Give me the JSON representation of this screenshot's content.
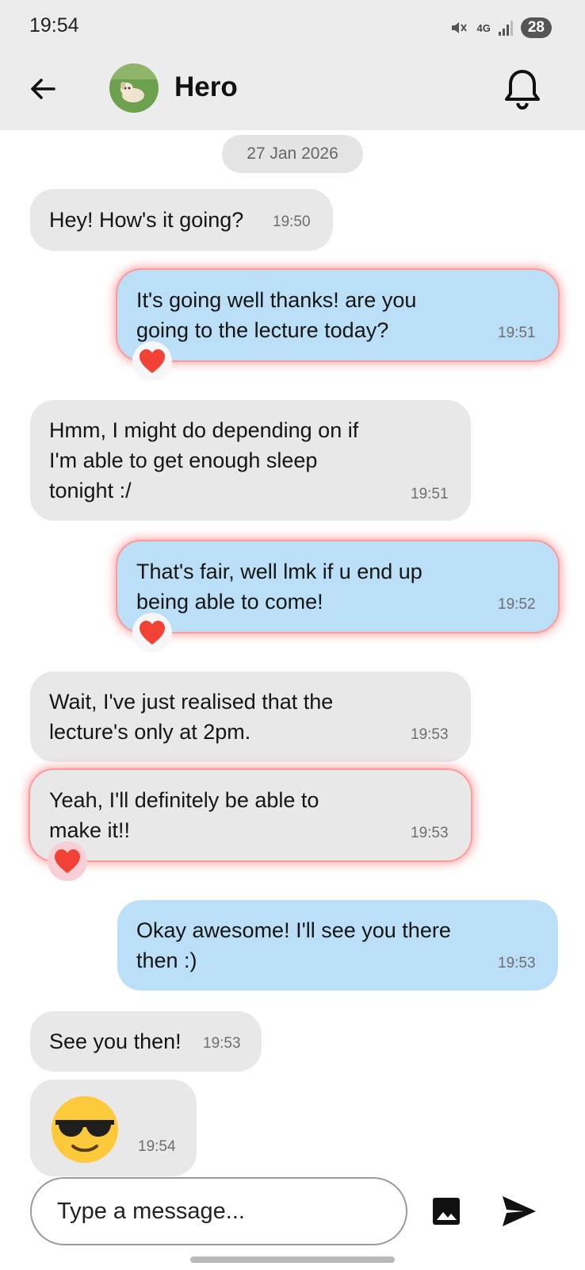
{
  "status_bar": {
    "time": "19:54",
    "network": "4G",
    "battery": "28"
  },
  "header": {
    "back_icon": "arrow-left-icon",
    "contact_name": "Hero",
    "avatar_icon": "dog-photo-avatar",
    "bell_icon": "bell-icon"
  },
  "date_separator": "27 Jan 2026",
  "messages": [
    {
      "direction": "incoming",
      "lines": [
        "Hey! How's it going?"
      ],
      "time": "19:50",
      "reacted": false
    },
    {
      "direction": "outgoing",
      "lines": [
        "It's going well thanks! are you",
        "going to the lecture today?"
      ],
      "time": "19:51",
      "reacted": true,
      "reaction": "heart-icon"
    },
    {
      "direction": "incoming",
      "lines": [
        "Hmm, I might do depending on if",
        "I'm able to get enough sleep",
        "tonight :/"
      ],
      "time": "19:51",
      "reacted": false
    },
    {
      "direction": "outgoing",
      "lines": [
        "That's fair, well lmk if u end up",
        "being able to come!"
      ],
      "time": "19:52",
      "reacted": true,
      "reaction": "heart-icon"
    },
    {
      "direction": "incoming",
      "lines": [
        "Wait, I've just realised that the",
        "lecture's only at 2pm."
      ],
      "time": "19:53",
      "reacted": false
    },
    {
      "direction": "incoming",
      "lines": [
        "Yeah, I'll definitely be able to",
        "make it!!"
      ],
      "time": "19:53",
      "reacted": true,
      "reaction": "heart-icon"
    },
    {
      "direction": "outgoing",
      "lines": [
        "Okay awesome! I'll see you there",
        "then :)"
      ],
      "time": "19:53",
      "reacted": false
    },
    {
      "direction": "incoming",
      "lines": [
        "See you then!"
      ],
      "time": "19:53",
      "reacted": false
    },
    {
      "direction": "incoming",
      "lines": [
        "😎"
      ],
      "time": "19:54",
      "reacted": false
    }
  ],
  "composer": {
    "placeholder": "Type a message...",
    "image_icon": "image-icon",
    "send_icon": "send-icon"
  },
  "colors": {
    "incoming_bubble": "#e8e8e8",
    "outgoing_bubble": "#bcdff8",
    "highlight_glow": "#ff6b6b",
    "heart": "#f24236",
    "app_bar": "#ececec"
  }
}
